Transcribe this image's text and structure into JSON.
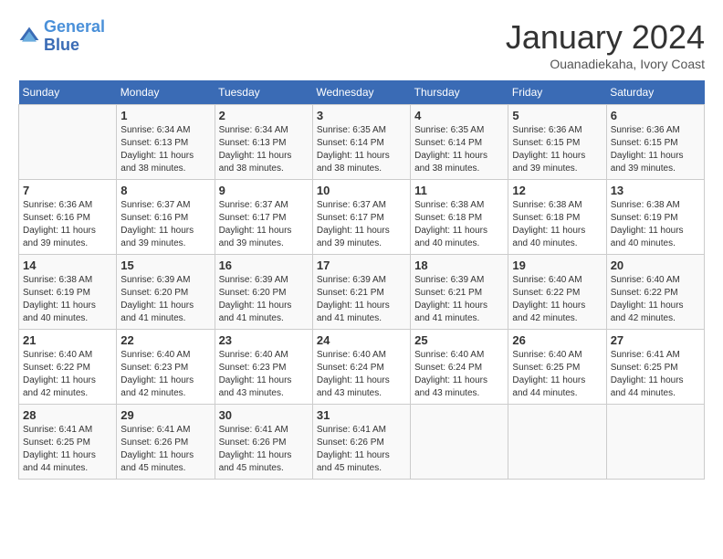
{
  "logo": {
    "line1": "General",
    "line2": "Blue"
  },
  "title": "January 2024",
  "subtitle": "Ouanadiekaha, Ivory Coast",
  "days_of_week": [
    "Sunday",
    "Monday",
    "Tuesday",
    "Wednesday",
    "Thursday",
    "Friday",
    "Saturday"
  ],
  "weeks": [
    [
      {
        "day": "",
        "sunrise": "",
        "sunset": "",
        "daylight": ""
      },
      {
        "day": "1",
        "sunrise": "Sunrise: 6:34 AM",
        "sunset": "Sunset: 6:13 PM",
        "daylight": "Daylight: 11 hours and 38 minutes."
      },
      {
        "day": "2",
        "sunrise": "Sunrise: 6:34 AM",
        "sunset": "Sunset: 6:13 PM",
        "daylight": "Daylight: 11 hours and 38 minutes."
      },
      {
        "day": "3",
        "sunrise": "Sunrise: 6:35 AM",
        "sunset": "Sunset: 6:14 PM",
        "daylight": "Daylight: 11 hours and 38 minutes."
      },
      {
        "day": "4",
        "sunrise": "Sunrise: 6:35 AM",
        "sunset": "Sunset: 6:14 PM",
        "daylight": "Daylight: 11 hours and 38 minutes."
      },
      {
        "day": "5",
        "sunrise": "Sunrise: 6:36 AM",
        "sunset": "Sunset: 6:15 PM",
        "daylight": "Daylight: 11 hours and 39 minutes."
      },
      {
        "day": "6",
        "sunrise": "Sunrise: 6:36 AM",
        "sunset": "Sunset: 6:15 PM",
        "daylight": "Daylight: 11 hours and 39 minutes."
      }
    ],
    [
      {
        "day": "7",
        "sunrise": "Sunrise: 6:36 AM",
        "sunset": "Sunset: 6:16 PM",
        "daylight": "Daylight: 11 hours and 39 minutes."
      },
      {
        "day": "8",
        "sunrise": "Sunrise: 6:37 AM",
        "sunset": "Sunset: 6:16 PM",
        "daylight": "Daylight: 11 hours and 39 minutes."
      },
      {
        "day": "9",
        "sunrise": "Sunrise: 6:37 AM",
        "sunset": "Sunset: 6:17 PM",
        "daylight": "Daylight: 11 hours and 39 minutes."
      },
      {
        "day": "10",
        "sunrise": "Sunrise: 6:37 AM",
        "sunset": "Sunset: 6:17 PM",
        "daylight": "Daylight: 11 hours and 39 minutes."
      },
      {
        "day": "11",
        "sunrise": "Sunrise: 6:38 AM",
        "sunset": "Sunset: 6:18 PM",
        "daylight": "Daylight: 11 hours and 40 minutes."
      },
      {
        "day": "12",
        "sunrise": "Sunrise: 6:38 AM",
        "sunset": "Sunset: 6:18 PM",
        "daylight": "Daylight: 11 hours and 40 minutes."
      },
      {
        "day": "13",
        "sunrise": "Sunrise: 6:38 AM",
        "sunset": "Sunset: 6:19 PM",
        "daylight": "Daylight: 11 hours and 40 minutes."
      }
    ],
    [
      {
        "day": "14",
        "sunrise": "Sunrise: 6:38 AM",
        "sunset": "Sunset: 6:19 PM",
        "daylight": "Daylight: 11 hours and 40 minutes."
      },
      {
        "day": "15",
        "sunrise": "Sunrise: 6:39 AM",
        "sunset": "Sunset: 6:20 PM",
        "daylight": "Daylight: 11 hours and 41 minutes."
      },
      {
        "day": "16",
        "sunrise": "Sunrise: 6:39 AM",
        "sunset": "Sunset: 6:20 PM",
        "daylight": "Daylight: 11 hours and 41 minutes."
      },
      {
        "day": "17",
        "sunrise": "Sunrise: 6:39 AM",
        "sunset": "Sunset: 6:21 PM",
        "daylight": "Daylight: 11 hours and 41 minutes."
      },
      {
        "day": "18",
        "sunrise": "Sunrise: 6:39 AM",
        "sunset": "Sunset: 6:21 PM",
        "daylight": "Daylight: 11 hours and 41 minutes."
      },
      {
        "day": "19",
        "sunrise": "Sunrise: 6:40 AM",
        "sunset": "Sunset: 6:22 PM",
        "daylight": "Daylight: 11 hours and 42 minutes."
      },
      {
        "day": "20",
        "sunrise": "Sunrise: 6:40 AM",
        "sunset": "Sunset: 6:22 PM",
        "daylight": "Daylight: 11 hours and 42 minutes."
      }
    ],
    [
      {
        "day": "21",
        "sunrise": "Sunrise: 6:40 AM",
        "sunset": "Sunset: 6:22 PM",
        "daylight": "Daylight: 11 hours and 42 minutes."
      },
      {
        "day": "22",
        "sunrise": "Sunrise: 6:40 AM",
        "sunset": "Sunset: 6:23 PM",
        "daylight": "Daylight: 11 hours and 42 minutes."
      },
      {
        "day": "23",
        "sunrise": "Sunrise: 6:40 AM",
        "sunset": "Sunset: 6:23 PM",
        "daylight": "Daylight: 11 hours and 43 minutes."
      },
      {
        "day": "24",
        "sunrise": "Sunrise: 6:40 AM",
        "sunset": "Sunset: 6:24 PM",
        "daylight": "Daylight: 11 hours and 43 minutes."
      },
      {
        "day": "25",
        "sunrise": "Sunrise: 6:40 AM",
        "sunset": "Sunset: 6:24 PM",
        "daylight": "Daylight: 11 hours and 43 minutes."
      },
      {
        "day": "26",
        "sunrise": "Sunrise: 6:40 AM",
        "sunset": "Sunset: 6:25 PM",
        "daylight": "Daylight: 11 hours and 44 minutes."
      },
      {
        "day": "27",
        "sunrise": "Sunrise: 6:41 AM",
        "sunset": "Sunset: 6:25 PM",
        "daylight": "Daylight: 11 hours and 44 minutes."
      }
    ],
    [
      {
        "day": "28",
        "sunrise": "Sunrise: 6:41 AM",
        "sunset": "Sunset: 6:25 PM",
        "daylight": "Daylight: 11 hours and 44 minutes."
      },
      {
        "day": "29",
        "sunrise": "Sunrise: 6:41 AM",
        "sunset": "Sunset: 6:26 PM",
        "daylight": "Daylight: 11 hours and 45 minutes."
      },
      {
        "day": "30",
        "sunrise": "Sunrise: 6:41 AM",
        "sunset": "Sunset: 6:26 PM",
        "daylight": "Daylight: 11 hours and 45 minutes."
      },
      {
        "day": "31",
        "sunrise": "Sunrise: 6:41 AM",
        "sunset": "Sunset: 6:26 PM",
        "daylight": "Daylight: 11 hours and 45 minutes."
      },
      {
        "day": "",
        "sunrise": "",
        "sunset": "",
        "daylight": ""
      },
      {
        "day": "",
        "sunrise": "",
        "sunset": "",
        "daylight": ""
      },
      {
        "day": "",
        "sunrise": "",
        "sunset": "",
        "daylight": ""
      }
    ]
  ]
}
